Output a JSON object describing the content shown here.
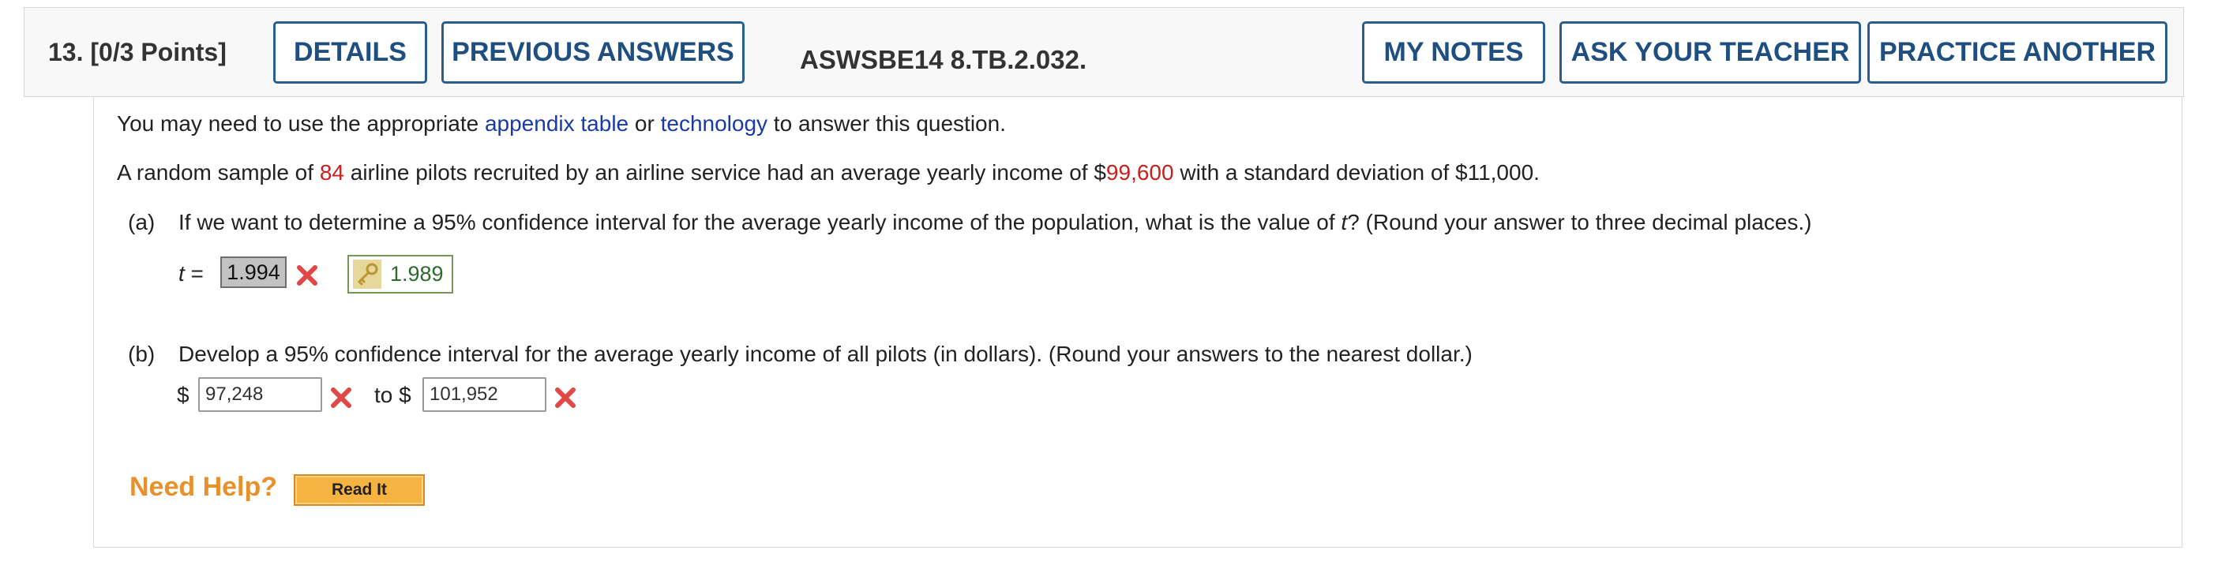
{
  "header": {
    "question_label": "13.  [0/3 Points]",
    "details_button": "DETAILS",
    "previous_answers_button": "PREVIOUS ANSWERS",
    "question_code": "ASWSBE14 8.TB.2.032.",
    "my_notes_button": "MY NOTES",
    "ask_teacher_button": "ASK YOUR TEACHER",
    "practice_another_button": "PRACTICE ANOTHER"
  },
  "intro": {
    "prefix": "You may need to use the appropriate ",
    "link_appendix": "appendix table",
    "middle": " or ",
    "link_technology": "technology",
    "suffix": " to answer this question."
  },
  "problem": {
    "part1": "A random sample of ",
    "n": "84",
    "part2": " airline pilots recruited by an airline service had an average yearly income of $",
    "mean": "99,600",
    "part3": " with a standard deviation of $11,000."
  },
  "part_a": {
    "tag": "(a)",
    "text_before": "If we want to determine a 95% confidence interval for the average yearly income of the population, what is the value of ",
    "var": "t",
    "text_after": "? (Round your answer to three decimal places.)",
    "label_var": "t",
    "label_eq": " = ",
    "answer": "1.994",
    "answer_status": "incorrect",
    "correct_answer": "1.989"
  },
  "part_b": {
    "tag": "(b)",
    "text": "Develop a 95% confidence interval for the average yearly income of all pilots (in dollars). (Round your answers to the nearest dollar.)",
    "dollar1": "$",
    "lower": "97,248",
    "to_label": "to $",
    "upper": "101,952",
    "status": "incorrect"
  },
  "help": {
    "label": "Need Help?",
    "read_it_button": "Read It"
  },
  "icons": {
    "incorrect": "x-mark-icon",
    "key": "key-icon"
  },
  "colors": {
    "button_border": "#2a5d90",
    "link": "#1a3aa8",
    "highlight_red": "#c8201c",
    "incorrect_x": "#e04848",
    "correct_green": "#2d6b2d",
    "need_help_orange": "#e8912c"
  }
}
